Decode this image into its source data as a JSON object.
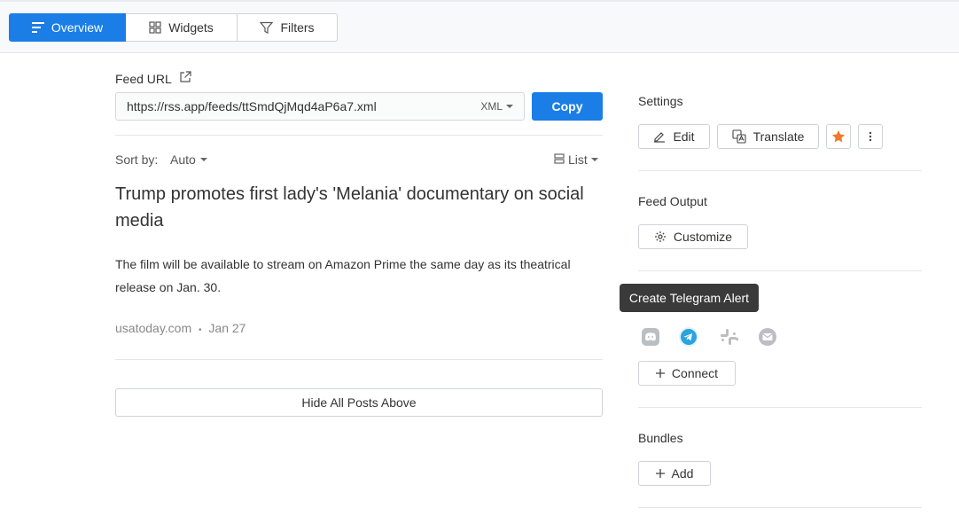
{
  "tabs": [
    {
      "label": "Overview",
      "icon": "list-lines-icon",
      "active": true
    },
    {
      "label": "Widgets",
      "icon": "grid-icon",
      "active": false
    },
    {
      "label": "Filters",
      "icon": "funnel-icon",
      "active": false
    }
  ],
  "feed": {
    "label": "Feed URL",
    "url": "https://rss.app/feeds/ttSmdQjMqd4aP6a7.xml",
    "format": "XML",
    "copy_label": "Copy"
  },
  "sort": {
    "label": "Sort by:",
    "value": "Auto",
    "view": "List"
  },
  "article": {
    "title": "Trump promotes first lady's 'Melania' documentary on social media",
    "description": "The film will be available to stream on Amazon Prime the same day as its theatrical release on Jan. 30.",
    "source": "usatoday.com",
    "separator": "•",
    "date": "Jan 27"
  },
  "hide_posts_label": "Hide All Posts Above",
  "settings": {
    "title": "Settings",
    "edit_label": "Edit",
    "translate_label": "Translate"
  },
  "feed_output": {
    "title": "Feed Output",
    "customize_label": "Customize"
  },
  "alerts": {
    "tooltip": "Create Telegram Alert",
    "icons": [
      "discord-icon",
      "telegram-icon",
      "slack-icon",
      "email-icon"
    ],
    "connect_label": "Connect"
  },
  "bundles": {
    "title": "Bundles",
    "add_label": "Add"
  },
  "colors": {
    "accent": "#1a7ee6",
    "star": "#f07a2b",
    "telegram": "#2aa3e0"
  }
}
